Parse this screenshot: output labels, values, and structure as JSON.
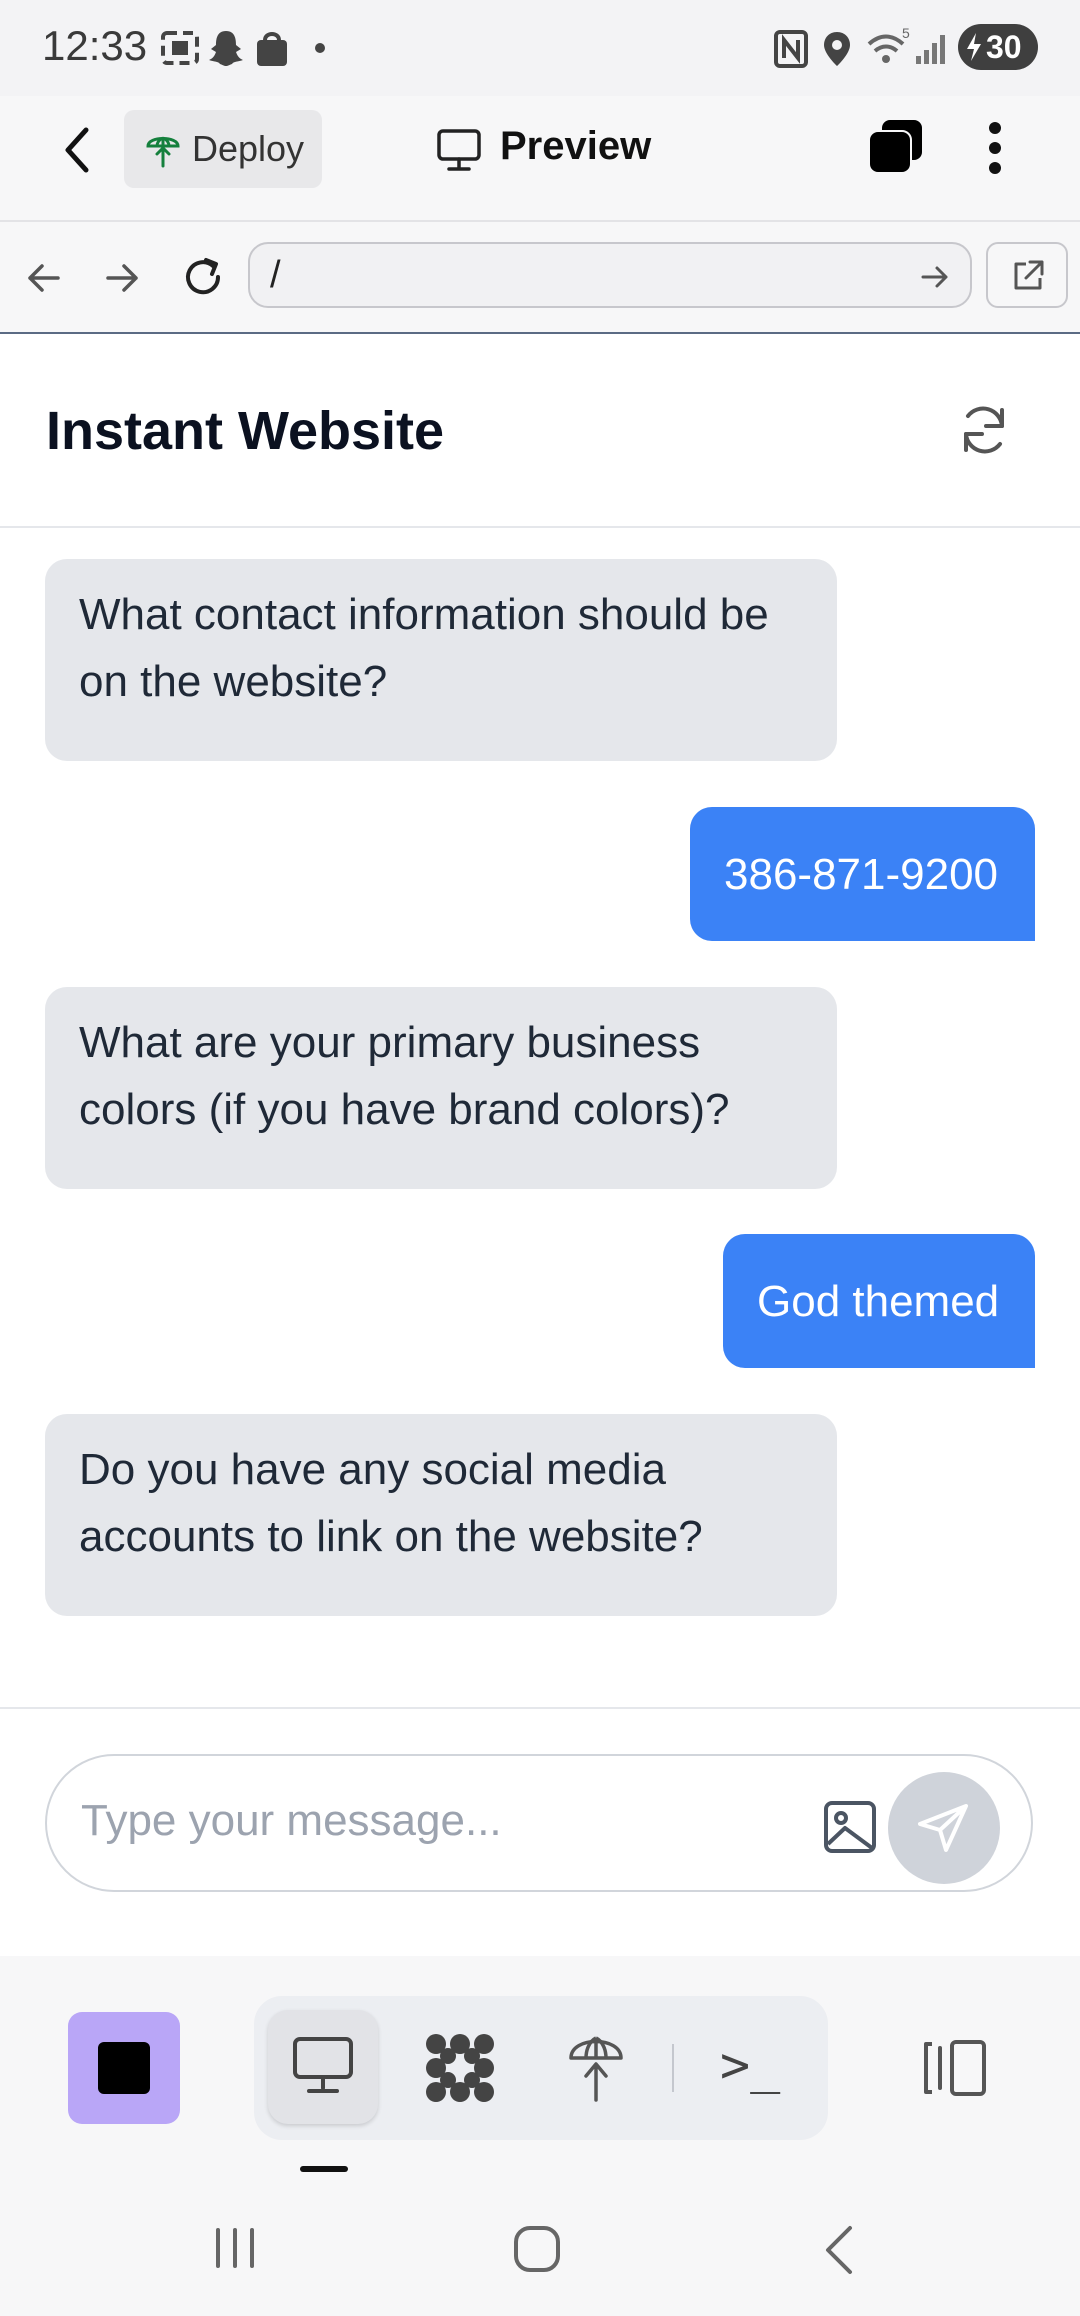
{
  "status_bar": {
    "time": "12:33",
    "battery": "30"
  },
  "header": {
    "deploy_label": "Deploy",
    "preview_label": "Preview"
  },
  "url_bar": {
    "value": "/"
  },
  "page": {
    "title": "Instant Website"
  },
  "messages": [
    {
      "role": "assistant",
      "text": "What contact information should be on the website?"
    },
    {
      "role": "user",
      "text": "386-871-9200"
    },
    {
      "role": "assistant",
      "text": "What are your primary business colors (if you have brand colors)?"
    },
    {
      "role": "user",
      "text": "God themed"
    },
    {
      "role": "assistant",
      "text": "Do you have any social media accounts to link on the website?"
    }
  ],
  "composer": {
    "placeholder": "Type your message..."
  },
  "toolbar": {
    "icons": [
      "stop-icon",
      "desktop-icon",
      "apps-icon",
      "deploy-icon",
      "terminal-icon",
      "panel-toggle-icon"
    ],
    "terminal_glyph": ">_"
  },
  "colors": {
    "accent": "#3b82f6",
    "bot_bubble": "#e5e7eb",
    "stop_button": "#b9a6f7"
  }
}
